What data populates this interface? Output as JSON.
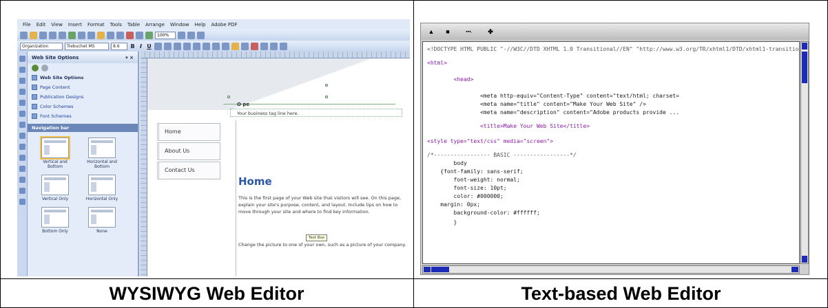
{
  "captions": {
    "left": "WYSIWYG Web Editor",
    "right": "Text-based Web Editor"
  },
  "wysiwyg": {
    "menu": [
      "File",
      "Edit",
      "View",
      "Insert",
      "Format",
      "Tools",
      "Table",
      "Arrange",
      "Window",
      "Help",
      "Adobe PDF"
    ],
    "style_combo": "Organization",
    "font_combo": "Trebuchet MS",
    "size_combo": "8.6",
    "zoom": "100%",
    "taskpane": {
      "title": "Web Site Options",
      "close": "▾ ×",
      "heading": "Web Site Options",
      "links": [
        "Page Content",
        "Publication Designs",
        "Color Schemes",
        "Font Schemes"
      ],
      "section": "Navigation bar",
      "thumbs": [
        "Vertical and Bottom",
        "Horizontal and Bottom",
        "Vertical Only",
        "Horizontal Only",
        "Bottom Only",
        "None"
      ]
    },
    "page": {
      "brand": "O pe",
      "tagline": "Your business tag line here.",
      "nav": [
        "Home",
        "About Us",
        "Contact Us"
      ],
      "heading": "Home",
      "body": "This is the first page of your Web site that visitors will see. On this page, explain your site's purpose, content, and layout. Include tips on how to move through your site and where to find key information.",
      "tooltip": "Text Box",
      "body2": "Change the picture to one of your own, such as a picture of your company."
    }
  },
  "texteditor": {
    "toolbar": [
      "▲",
      "■",
      "▪▪▪.",
      "✤"
    ],
    "lines": [
      {
        "text": "<!DOCTYPE HTML PUBLIC \"-//W3C//DTD XHTML 1.0 Transitional//EN\" \"http://www.w3.org/TR/xhtml1/DTD/xhtml1-transitional.dtd\">",
        "color": "#555555"
      },
      {
        "text": "<html>",
        "color": "#8b1aa8"
      },
      {
        "text": "        <head>",
        "color": "#8b1aa8"
      },
      {
        "text": "                <meta http-equiv=\"Content-Type\" content=\"text/html; charset=",
        "color": "#1a1a1a"
      },
      {
        "text": "                <meta name=\"title\" content=\"Make Your Web Site\" />",
        "color": "#1a1a1a"
      },
      {
        "text": "                <meta name=\"description\" content=\"Adobe products provide ...",
        "color": "#1a1a1a"
      },
      {
        "text": "                <title>Make Your Web Site</title>",
        "color": "#8b1aa8"
      },
      {
        "text": "<style type=\"text/css\" media=\"screen\">",
        "color": "#8b1aa8"
      },
      {
        "text": "/*----------------- BASIC -----------------*/",
        "color": "#555555"
      },
      {
        "text": "        body",
        "color": "#1a1a1a"
      },
      {
        "text": "    {font-family: sans-serif;",
        "color": "#1a1a1a"
      },
      {
        "text": "        font-weight: normal;",
        "color": "#1a1a1a"
      },
      {
        "text": "        font-size: 10pt;",
        "color": "#1a1a1a"
      },
      {
        "text": "        color: #000000;",
        "color": "#1a1a1a"
      },
      {
        "text": "    margin: 0px;",
        "color": "#1a1a1a"
      },
      {
        "text": "        background-color: #ffffff;",
        "color": "#1a1a1a"
      },
      {
        "text": "        }",
        "color": "#1a1a1a"
      }
    ]
  }
}
